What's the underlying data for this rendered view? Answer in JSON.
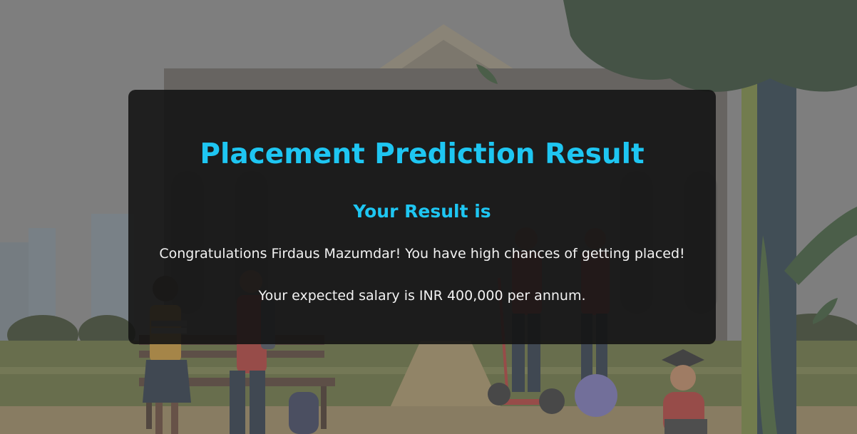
{
  "card": {
    "title": "Placement Prediction Result",
    "subtitle": "Your Result is",
    "message": "Congratulations Firdaus Mazumdar! You have high chances of getting placed!",
    "salary_text": "Your expected salary is INR 400,000 per annum."
  },
  "colors": {
    "accent": "#1ec6f2",
    "card_background": "#121212",
    "page_overlay": "#7c7c7c",
    "grass": "#5f6b33",
    "path": "#9a8659",
    "tree_dark": "#253b27",
    "tree_trunk": "#6b7a34"
  },
  "icons": {
    "background": "campus-illustration",
    "building": "university-building-illustration",
    "tree": "tree-illustration",
    "students": "students-illustration",
    "graduate": "graduate-cap-illustration"
  }
}
